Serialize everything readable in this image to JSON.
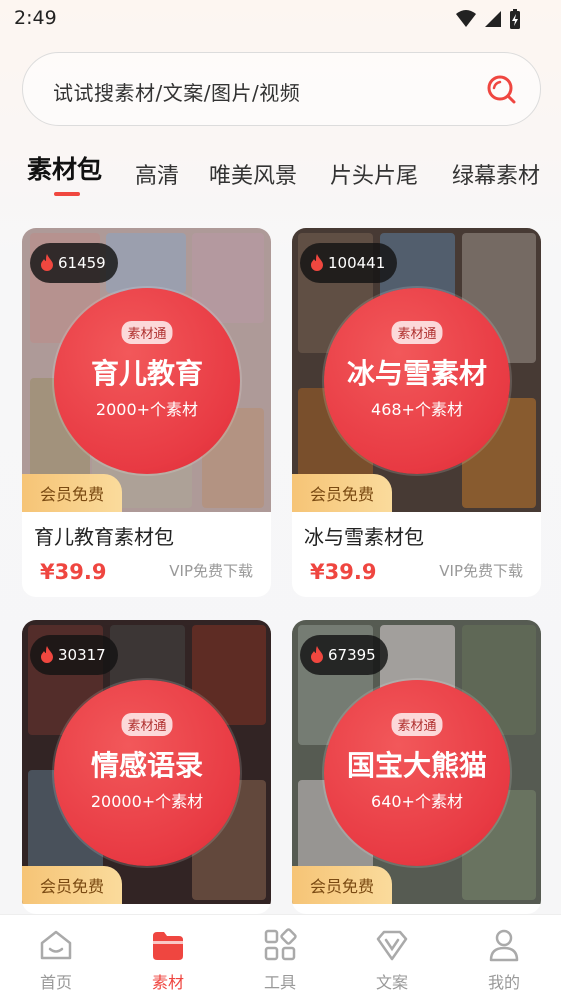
{
  "status_bar": {
    "time": "2:49"
  },
  "search": {
    "placeholder": "试试搜素材/文案/图片/视频"
  },
  "tabs": [
    {
      "label": "素材包",
      "active": true
    },
    {
      "label": "高清",
      "active": false
    },
    {
      "label": "唯美风景",
      "active": false
    },
    {
      "label": "片头片尾",
      "active": false
    },
    {
      "label": "绿幕素材",
      "active": false
    }
  ],
  "cards": [
    {
      "hot_count": "61459",
      "tag": "素材通",
      "cover_title": "育儿教育",
      "cover_count": "2000+个素材",
      "vip_badge": "会员免费",
      "title": "育儿教育素材包",
      "price": "¥39.9",
      "vip_text": "VIP免费下载"
    },
    {
      "hot_count": "100441",
      "tag": "素材通",
      "cover_title": "冰与雪素材",
      "cover_count": "468+个素材",
      "vip_badge": "会员免费",
      "title": "冰与雪素材包",
      "price": "¥39.9",
      "vip_text": "VIP免费下载"
    },
    {
      "hot_count": "30317",
      "tag": "素材通",
      "cover_title": "情感语录",
      "cover_count": "20000+个素材",
      "vip_badge": "会员免费",
      "title": "",
      "price": "",
      "vip_text": ""
    },
    {
      "hot_count": "67395",
      "tag": "素材通",
      "cover_title": "国宝大熊猫",
      "cover_count": "640+个素材",
      "vip_badge": "会员免费",
      "title": "",
      "price": "",
      "vip_text": ""
    }
  ],
  "bottom_nav": [
    {
      "label": "首页",
      "icon": "home-icon",
      "active": false
    },
    {
      "label": "素材",
      "icon": "folder-icon",
      "active": true
    },
    {
      "label": "工具",
      "icon": "tools-icon",
      "active": false
    },
    {
      "label": "文案",
      "icon": "diamond-v-icon",
      "active": false
    },
    {
      "label": "我的",
      "icon": "user-icon",
      "active": false
    }
  ],
  "colors": {
    "accent": "#ef4640",
    "vip_gold": "#f6c476",
    "circle_red": "#e83a43"
  }
}
